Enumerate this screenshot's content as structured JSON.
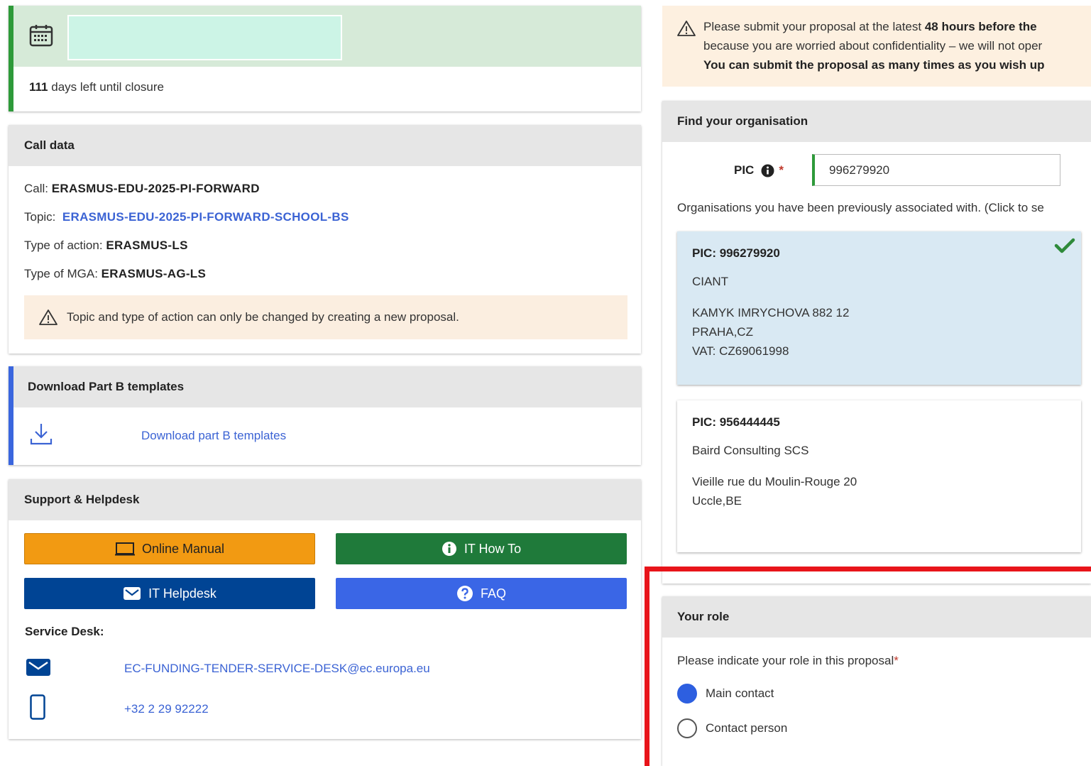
{
  "deadline": {
    "days_number": "111",
    "days_suffix": "days left until closure"
  },
  "call_data": {
    "title": "Call data",
    "call_label": "Call:",
    "call_value": "ERASMUS-EDU-2025-PI-FORWARD",
    "topic_label": "Topic:",
    "topic_value": "ERASMUS-EDU-2025-PI-FORWARD-SCHOOL-BS",
    "action_label": "Type of action:",
    "action_value": "ERASMUS-LS",
    "mga_label": "Type of MGA:",
    "mga_value": "ERASMUS-AG-LS",
    "warning": "Topic and type of action can only be changed by creating a new proposal."
  },
  "part_b": {
    "title": "Download Part B templates",
    "link": "Download part B templates"
  },
  "support": {
    "title": "Support & Helpdesk",
    "online_manual": "Online Manual",
    "it_how_to": "IT How To",
    "it_helpdesk": "IT Helpdesk",
    "faq": "FAQ",
    "service_desk_label": "Service Desk:",
    "email": "EC-FUNDING-TENDER-SERVICE-DESK@ec.europa.eu",
    "phone": "+32 2 29 92222"
  },
  "notice": {
    "line1_pre": "Please submit your proposal at the latest ",
    "line1_bold": "48 hours before the",
    "line2": "because you are worried about confidentiality – we will not oper",
    "line3": "You can submit the proposal as many times as you wish up"
  },
  "organisation": {
    "title": "Find your organisation",
    "pic_label": "PIC",
    "pic_value": "996279920",
    "associated_text": "Organisations you have been previously associated with. (Click to se",
    "orgs": [
      {
        "pic": "PIC: 996279920",
        "name": "CIANT",
        "addr1": "KAMYK IMRYCHOVA 882 12",
        "addr2": "PRAHA,CZ",
        "addr3": "VAT: CZ69061998",
        "selected": true
      },
      {
        "pic": "PIC: 956444445",
        "name": "Baird Consulting SCS",
        "addr1": "Vieille rue du Moulin-Rouge 20",
        "addr2": "Uccle,BE",
        "addr3": "",
        "selected": false
      }
    ]
  },
  "role": {
    "title": "Your role",
    "question": "Please indicate your role in this proposal",
    "options": [
      "Main contact",
      "Contact person"
    ],
    "selected": "Main contact"
  },
  "colors": {
    "link": "#3b63d4",
    "highlight": "#e8141a",
    "success": "#2e9a3a"
  }
}
